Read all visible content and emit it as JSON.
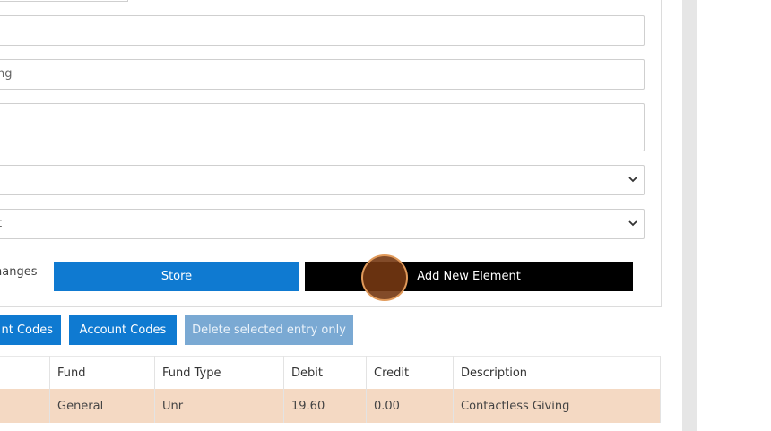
{
  "form": {
    "fields": [
      {
        "value": ""
      },
      {
        "value": "ng"
      },
      {
        "value": ""
      }
    ],
    "selects": [
      {
        "value": "",
        "icon": "chevron-down-icon"
      },
      {
        "value": "t",
        "icon": "chevron-down-icon"
      }
    ],
    "changes_label": "hanges",
    "store_label": "Store",
    "add_label": "Add New Element"
  },
  "actions": {
    "account_codes_left": "nt Codes",
    "account_codes": "Account Codes",
    "delete_entry": "Delete selected entry only"
  },
  "table": {
    "headers": [
      "",
      "Fund",
      "Fund Type",
      "Debit",
      "Credit",
      "Description"
    ],
    "rows": [
      [
        "",
        "General",
        "Unr",
        "19.60",
        "0.00",
        "Contactless Giving"
      ]
    ]
  },
  "colors": {
    "primary": "#0f7ad1",
    "disabled": "#7aa9d3",
    "highlight_row": "#f4d9c3"
  }
}
